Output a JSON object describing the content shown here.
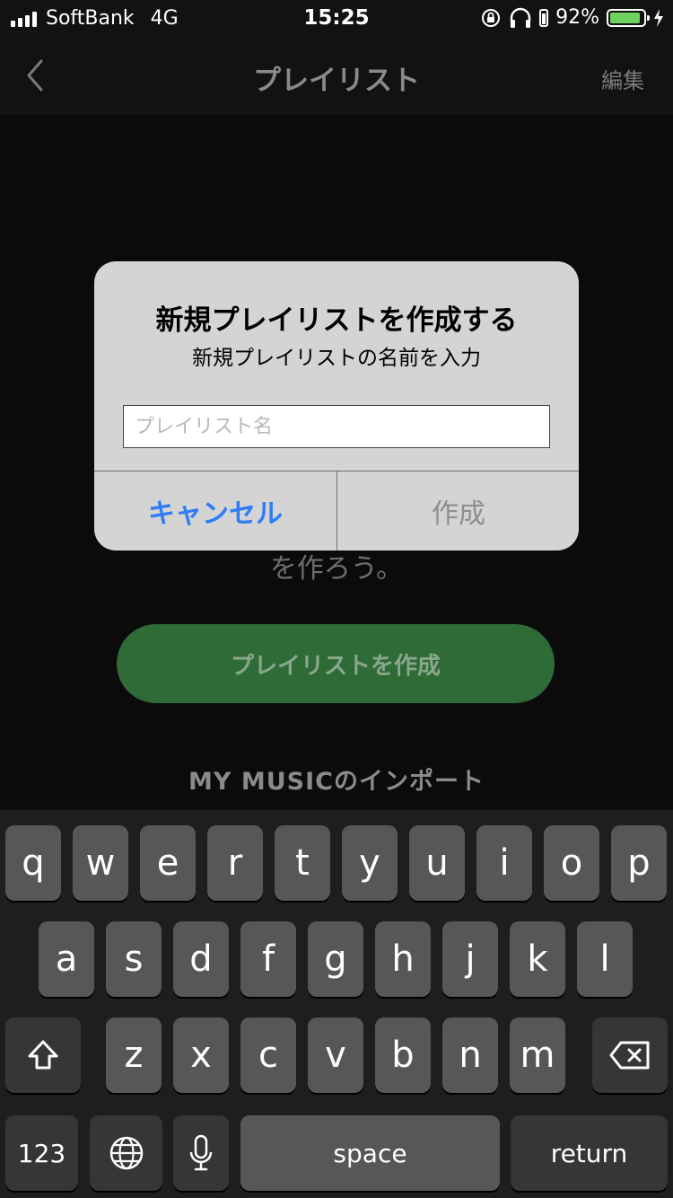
{
  "status_bar": {
    "carrier": "SoftBank",
    "network": "4G",
    "time": "15:25",
    "battery_percent": "92%",
    "battery_level": 0.92,
    "battery_color": "#6fd25e"
  },
  "nav": {
    "title": "プレイリスト",
    "edit": "編集",
    "back_icon": "chevron-left-icon"
  },
  "background": {
    "hint_text": "を作ろう。",
    "create_button": "プレイリストを作成",
    "import_label": "MY MUSICのインポート",
    "accent": "#2f6b36"
  },
  "dialog": {
    "title": "新規プレイリストを作成する",
    "message": "新規プレイリストの名前を入力",
    "input_placeholder": "プレイリスト名",
    "cancel": "キャンセル",
    "create": "作成",
    "cancel_color": "#2f7cf6"
  },
  "keyboard": {
    "row1": [
      "q",
      "w",
      "e",
      "r",
      "t",
      "y",
      "u",
      "i",
      "o",
      "p"
    ],
    "row2": [
      "a",
      "s",
      "d",
      "f",
      "g",
      "h",
      "j",
      "k",
      "l"
    ],
    "row3": [
      "z",
      "x",
      "c",
      "v",
      "b",
      "n",
      "m"
    ],
    "numbers": "123",
    "space": "space",
    "return": "return"
  }
}
